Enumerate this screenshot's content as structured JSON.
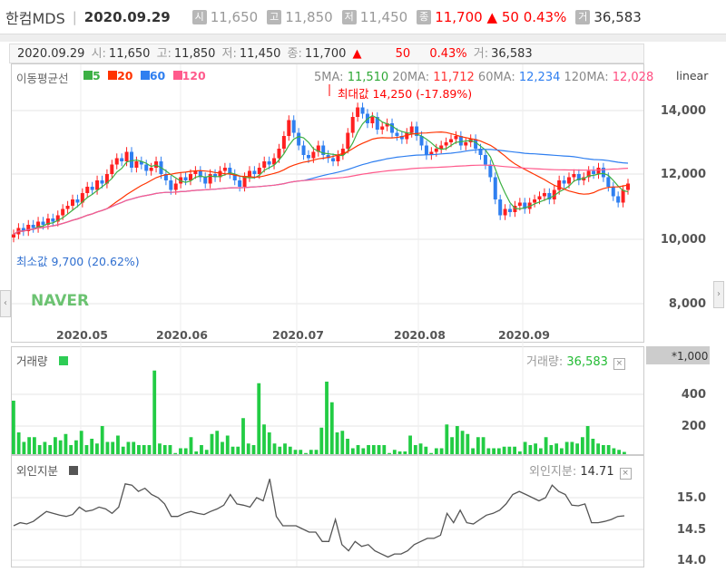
{
  "header": {
    "name": "한컴MDS",
    "date": "2020.09.29",
    "open_icon": "시",
    "open": "11,650",
    "high_icon": "고",
    "high": "11,850",
    "low_icon": "저",
    "low": "11,450",
    "close_icon": "종",
    "close": "11,700",
    "change_arrow": "▲",
    "change": "50",
    "pct": "0.43%",
    "vol_icon": "거",
    "volume": "36,583"
  },
  "info": {
    "date": "2020.09.29",
    "open_l": "시:",
    "open": "11,650",
    "high_l": "고:",
    "high": "11,850",
    "low_l": "저:",
    "low": "11,450",
    "close_l": "종:",
    "close": "11,700",
    "arrow": "▲",
    "change": "50",
    "pct": "0.43%",
    "vol_l": "거:",
    "volume": "36,583"
  },
  "price_panel": {
    "title": "이동평균선",
    "legend": [
      {
        "label": "5",
        "color": "#3cb043"
      },
      {
        "label": "20",
        "color": "#ff3300"
      },
      {
        "label": "60",
        "color": "#2f7ff0"
      },
      {
        "label": "120",
        "color": "#ff5a8c"
      }
    ],
    "ma_readout": [
      {
        "label": "5MA:",
        "value": "11,510",
        "color": "#2ea836"
      },
      {
        "label": "20MA:",
        "value": "11,712",
        "color": "#f33"
      },
      {
        "label": "60MA:",
        "value": "12,234",
        "color": "#2f7ff0"
      },
      {
        "label": "120MA:",
        "value": "12,028",
        "color": "#ff4d80"
      }
    ],
    "max_label": "최대값 14,250 (-17.89%)",
    "min_label": "최소값 9,700 (20.62%)",
    "scale_label": "linear",
    "watermark": "NAVER",
    "y_ticks": [
      "14,000",
      "12,000",
      "10,000",
      "8,000"
    ]
  },
  "x_ticks": [
    "2020.05",
    "2020.06",
    "2020.07",
    "2020.08",
    "2020.09"
  ],
  "volume_panel": {
    "title": "거래량",
    "color": "#22cc44",
    "readout_label": "거래량:",
    "readout_value": "36,583",
    "unit": "*1,000",
    "y_ticks": [
      "400",
      "200"
    ]
  },
  "foreign_panel": {
    "title": "외인지분",
    "color": "#555555",
    "readout_label": "외인지분:",
    "readout_value": "14.71",
    "y_ticks": [
      "15.0",
      "14.5",
      "14.0"
    ]
  },
  "colors": {
    "up": "#ff2020",
    "down": "#2f7ff0"
  },
  "chart_data": [
    {
      "type": "candlestick",
      "title": "이동평균선",
      "ylim": [
        7500,
        15200
      ],
      "moving_averages": [
        5,
        20,
        60,
        120
      ],
      "close": [
        10100,
        10300,
        10200,
        10400,
        10300,
        10500,
        10400,
        10600,
        10500,
        10700,
        10900,
        11000,
        11200,
        11100,
        11400,
        11600,
        11500,
        11800,
        11700,
        12000,
        12300,
        12500,
        12400,
        12700,
        12200,
        12400,
        12300,
        12100,
        12200,
        12400,
        12000,
        11800,
        11500,
        11700,
        11900,
        11800,
        12000,
        12100,
        11900,
        11700,
        12000,
        11900,
        12100,
        12200,
        12000,
        11800,
        11600,
        11900,
        12100,
        12000,
        12200,
        12400,
        12300,
        12500,
        12800,
        13200,
        13700,
        13300,
        12900,
        12600,
        12500,
        12700,
        12900,
        12600,
        12500,
        12400,
        12600,
        12800,
        13300,
        13800,
        14100,
        13900,
        13600,
        13800,
        13400,
        13500,
        13600,
        13300,
        13200,
        13100,
        13300,
        13500,
        13200,
        12900,
        12600,
        12700,
        12800,
        12900,
        13000,
        13100,
        13200,
        12900,
        13000,
        13100,
        12800,
        12600,
        12300,
        11900,
        11200,
        10700,
        10900,
        10800,
        11000,
        11100,
        10900,
        11100,
        11200,
        11300,
        11400,
        11200,
        11500,
        11800,
        11700,
        11900,
        12000,
        11800,
        11900,
        12100,
        12000,
        12200,
        11900,
        11600,
        11300,
        11100,
        11500,
        11700
      ]
    },
    {
      "type": "bar",
      "title": "거래량",
      "unit": "*1,000",
      "ylim": [
        0,
        620
      ],
      "values": [
        360,
        160,
        100,
        130,
        130,
        80,
        100,
        80,
        130,
        110,
        150,
        80,
        110,
        170,
        80,
        120,
        90,
        200,
        100,
        100,
        140,
        70,
        100,
        100,
        80,
        80,
        80,
        550,
        90,
        80,
        80,
        30,
        60,
        60,
        130,
        40,
        80,
        50,
        150,
        170,
        100,
        140,
        70,
        70,
        250,
        90,
        80,
        470,
        210,
        160,
        90,
        70,
        90,
        70,
        50,
        50,
        30,
        50,
        50,
        190,
        480,
        350,
        160,
        170,
        120,
        60,
        80,
        60,
        80,
        80,
        80,
        80,
        30,
        50,
        40,
        40,
        140,
        80,
        90,
        70,
        30,
        60,
        60,
        210,
        130,
        200,
        170,
        150,
        60,
        130,
        130,
        60,
        60,
        60,
        70,
        70,
        70,
        40,
        100,
        80,
        90,
        60,
        130,
        80,
        90,
        60,
        100,
        100,
        90,
        130,
        200,
        120,
        90,
        80,
        80,
        60,
        50,
        37
      ]
    },
    {
      "type": "line",
      "title": "외인지분",
      "ylim": [
        13.95,
        15.4
      ],
      "values": [
        14.55,
        14.6,
        14.58,
        14.62,
        14.7,
        14.78,
        14.75,
        14.72,
        14.7,
        14.73,
        14.85,
        14.78,
        14.8,
        14.85,
        14.82,
        14.75,
        14.85,
        15.22,
        15.2,
        15.1,
        15.15,
        15.05,
        15.0,
        14.9,
        14.7,
        14.7,
        14.75,
        14.78,
        14.75,
        14.73,
        14.78,
        14.82,
        14.88,
        15.05,
        14.9,
        14.88,
        14.85,
        15.0,
        14.95,
        15.3,
        14.7,
        14.55,
        14.55,
        14.55,
        14.5,
        14.45,
        14.45,
        14.3,
        14.3,
        14.65,
        14.25,
        14.15,
        14.3,
        14.22,
        14.25,
        14.15,
        14.1,
        14.05,
        14.1,
        14.1,
        14.15,
        14.25,
        14.3,
        14.35,
        14.35,
        14.4,
        14.75,
        14.6,
        14.8,
        14.6,
        14.58,
        14.65,
        14.72,
        14.75,
        14.8,
        14.9,
        15.05,
        15.1,
        15.05,
        15.0,
        14.95,
        15.0,
        15.2,
        15.1,
        15.05,
        14.88,
        14.87,
        14.9,
        14.6,
        14.6,
        14.62,
        14.65,
        14.7,
        14.71
      ]
    }
  ]
}
